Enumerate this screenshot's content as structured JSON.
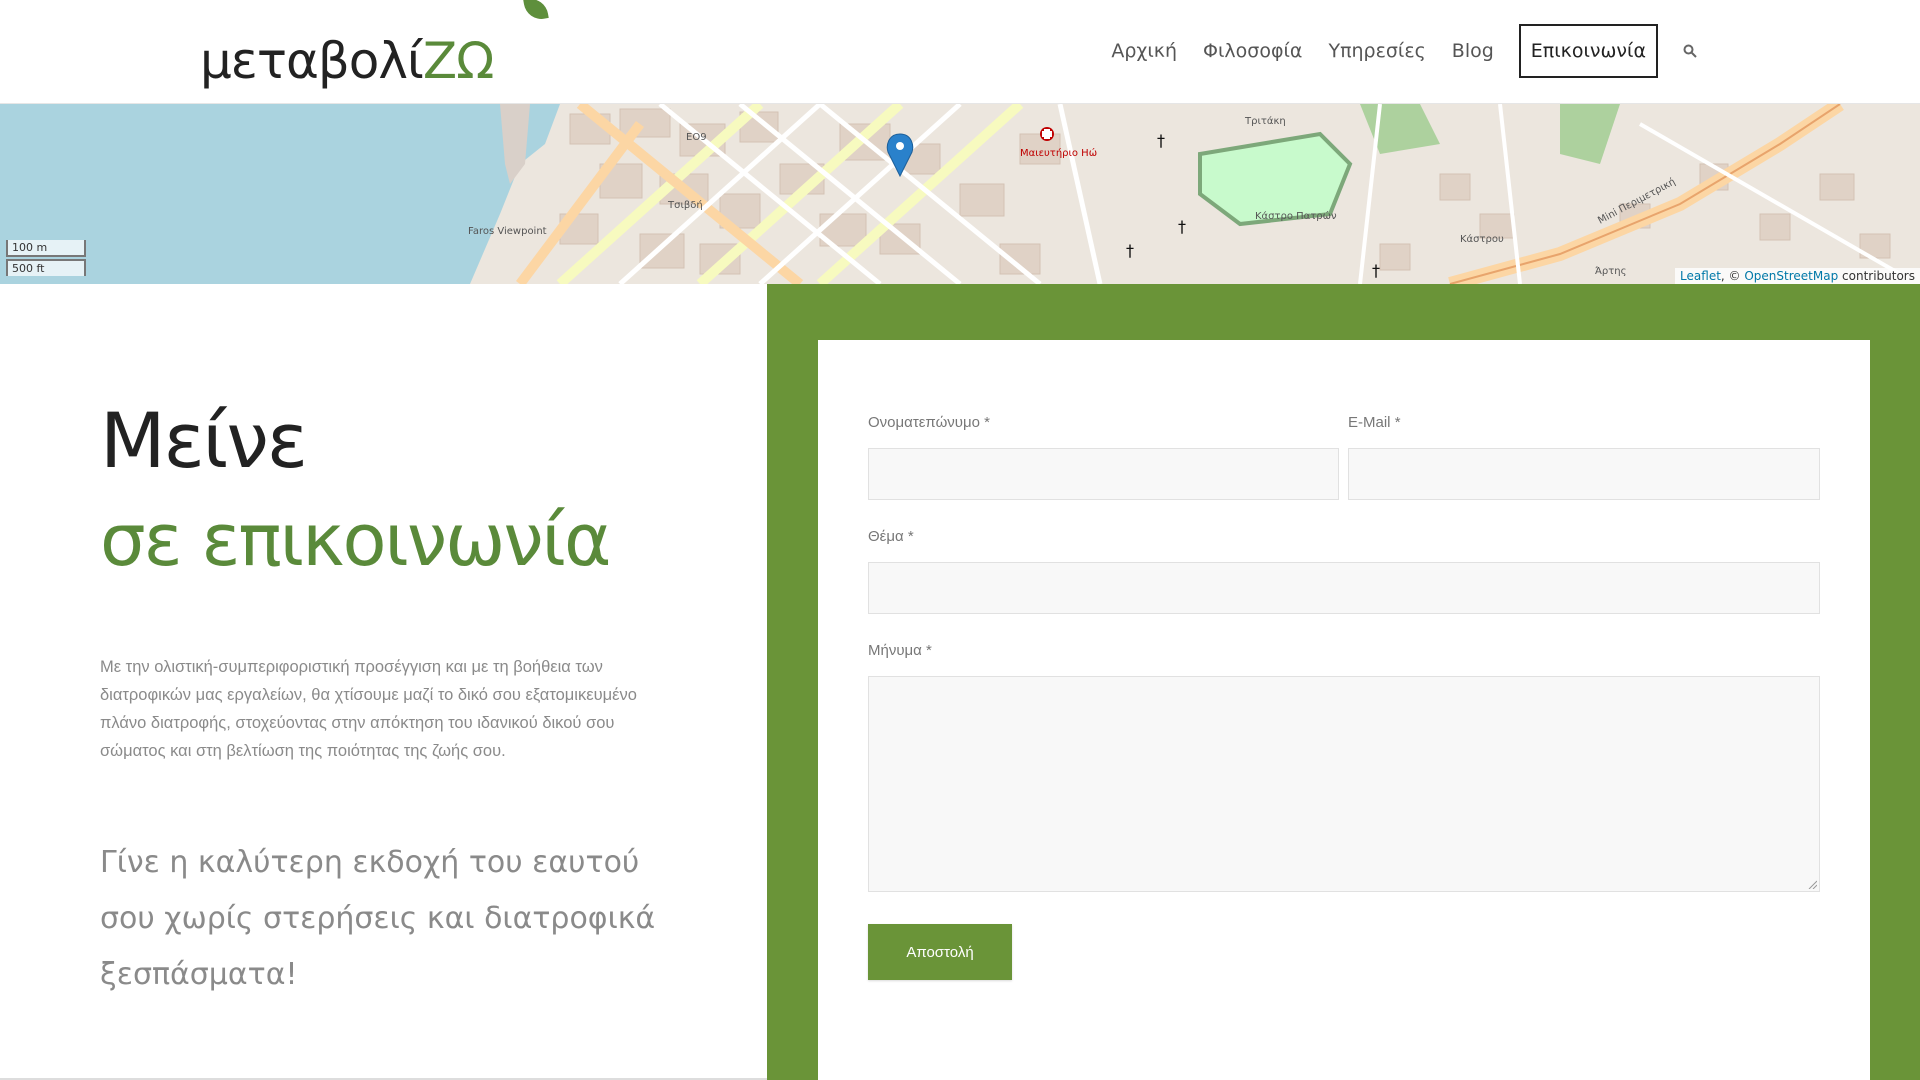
{
  "logo": {
    "text_main": "μεταβολί",
    "text_accent": "ΖΩ"
  },
  "nav": {
    "items": [
      "Αρχική",
      "Φιλοσοφία",
      "Υπηρεσίες",
      "Blog"
    ],
    "active": "Επικοινωνία",
    "search_icon": "search-icon"
  },
  "map": {
    "scale_m": "100 m",
    "scale_ft": "500 ft",
    "attribution_leaflet": "Leaflet",
    "attribution_sep": ", © ",
    "attribution_osm": "OpenStreetMap",
    "attribution_tail": " contributors",
    "labels": [
      "Faros Viewpoint",
      "Τριτάκη",
      "Κάστρο Πατρών",
      "Μαιευτήριο Ηώ",
      "Mini Περιμετρική",
      "EO9",
      "Τσιβδή",
      "Κάστρου",
      "Άρτης"
    ]
  },
  "intro": {
    "heading_line1": "Μείνε",
    "heading_line2": "σε επικοινωνία",
    "paragraph": "Με την ολιστική-συμπεριφοριστική προσέγγιση και με τη βοήθεια των διατροφικών μας εργαλείων, θα χτίσουμε μαζί το δικό σου εξατομικευμένο πλάνο διατροφής, στοχεύοντας στην απόκτηση του ιδανικού δικού σου σώματος και στη βελτίωση της ποιότητας της ζωής σου.",
    "tagline": "Γίνε η καλύτερη εκδοχή του εαυτού σου χωρίς στερήσεις και διατροφικά ξεσπάσματα!"
  },
  "form": {
    "name_label": "Ονοματεπώνυμο",
    "email_label": "E-Mail",
    "subject_label": "Θέμα",
    "message_label": "Μήνυμα",
    "required_mark": "*",
    "submit_label": "Αποστολή",
    "name_value": "",
    "email_value": "",
    "subject_value": "",
    "message_value": ""
  },
  "colors": {
    "accent": "#6a9438",
    "heading_green": "#5a8a3a",
    "water": "#aad3df"
  }
}
